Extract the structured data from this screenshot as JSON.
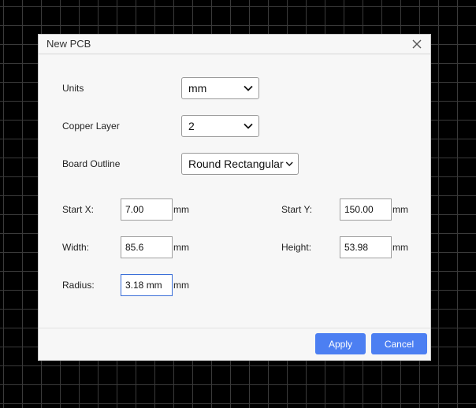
{
  "dialog": {
    "title": "New PCB"
  },
  "icons": {
    "close": "close-icon",
    "dropdown": "chevron-down-icon"
  },
  "form": {
    "units": {
      "label": "Units",
      "value": "mm"
    },
    "copper_layer": {
      "label": "Copper Layer",
      "value": "2"
    },
    "board_outline": {
      "label": "Board Outline",
      "value": "Round Rectangular"
    },
    "start_x": {
      "label": "Start X:",
      "value": "7.00",
      "unit": "mm"
    },
    "start_y": {
      "label": "Start Y:",
      "value": "150.00",
      "unit": "mm"
    },
    "width": {
      "label": "Width:",
      "value": "85.6",
      "unit": "mm"
    },
    "height": {
      "label": "Height:",
      "value": "53.98",
      "unit": "mm"
    },
    "radius": {
      "label": "Radius:",
      "value": "3.18 mm",
      "unit": "mm"
    }
  },
  "buttons": {
    "apply": "Apply",
    "cancel": "Cancel"
  },
  "colors": {
    "accent": "#4c7ff2",
    "focus": "#3b6fd8",
    "dialog_bg": "#f7f7f7",
    "canvas_bg": "#000000"
  }
}
